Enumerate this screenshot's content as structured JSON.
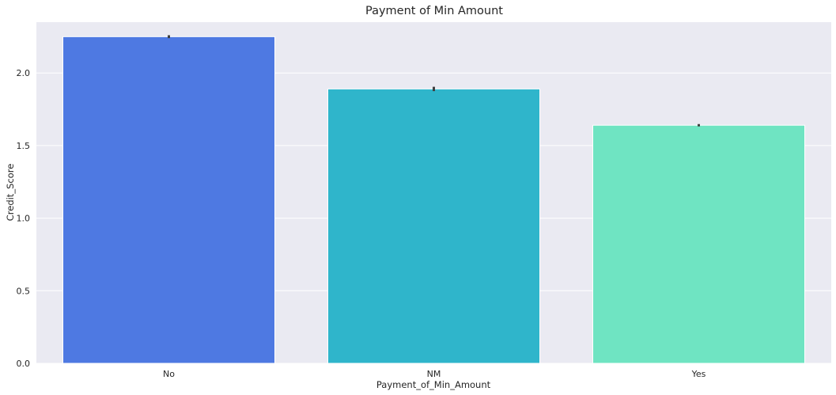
{
  "chart_data": {
    "type": "bar",
    "title": "Payment of Min Amount",
    "xlabel": "Payment_of_Min_Amount",
    "ylabel": "Credit_Score",
    "categories": [
      "No",
      "NM",
      "Yes"
    ],
    "values": [
      2.25,
      1.89,
      1.64
    ],
    "error_bars": [
      [
        2.24,
        2.26
      ],
      [
        1.875,
        1.905
      ],
      [
        1.632,
        1.648
      ]
    ],
    "colors": [
      "#4e79e2",
      "#2fb5cb",
      "#6fe4c2"
    ],
    "ylim": [
      0,
      2.35
    ],
    "yticks": [
      "0.0",
      "0.5",
      "1.0",
      "1.5",
      "2.0"
    ],
    "grid": true,
    "background": "#eaeaf2"
  }
}
